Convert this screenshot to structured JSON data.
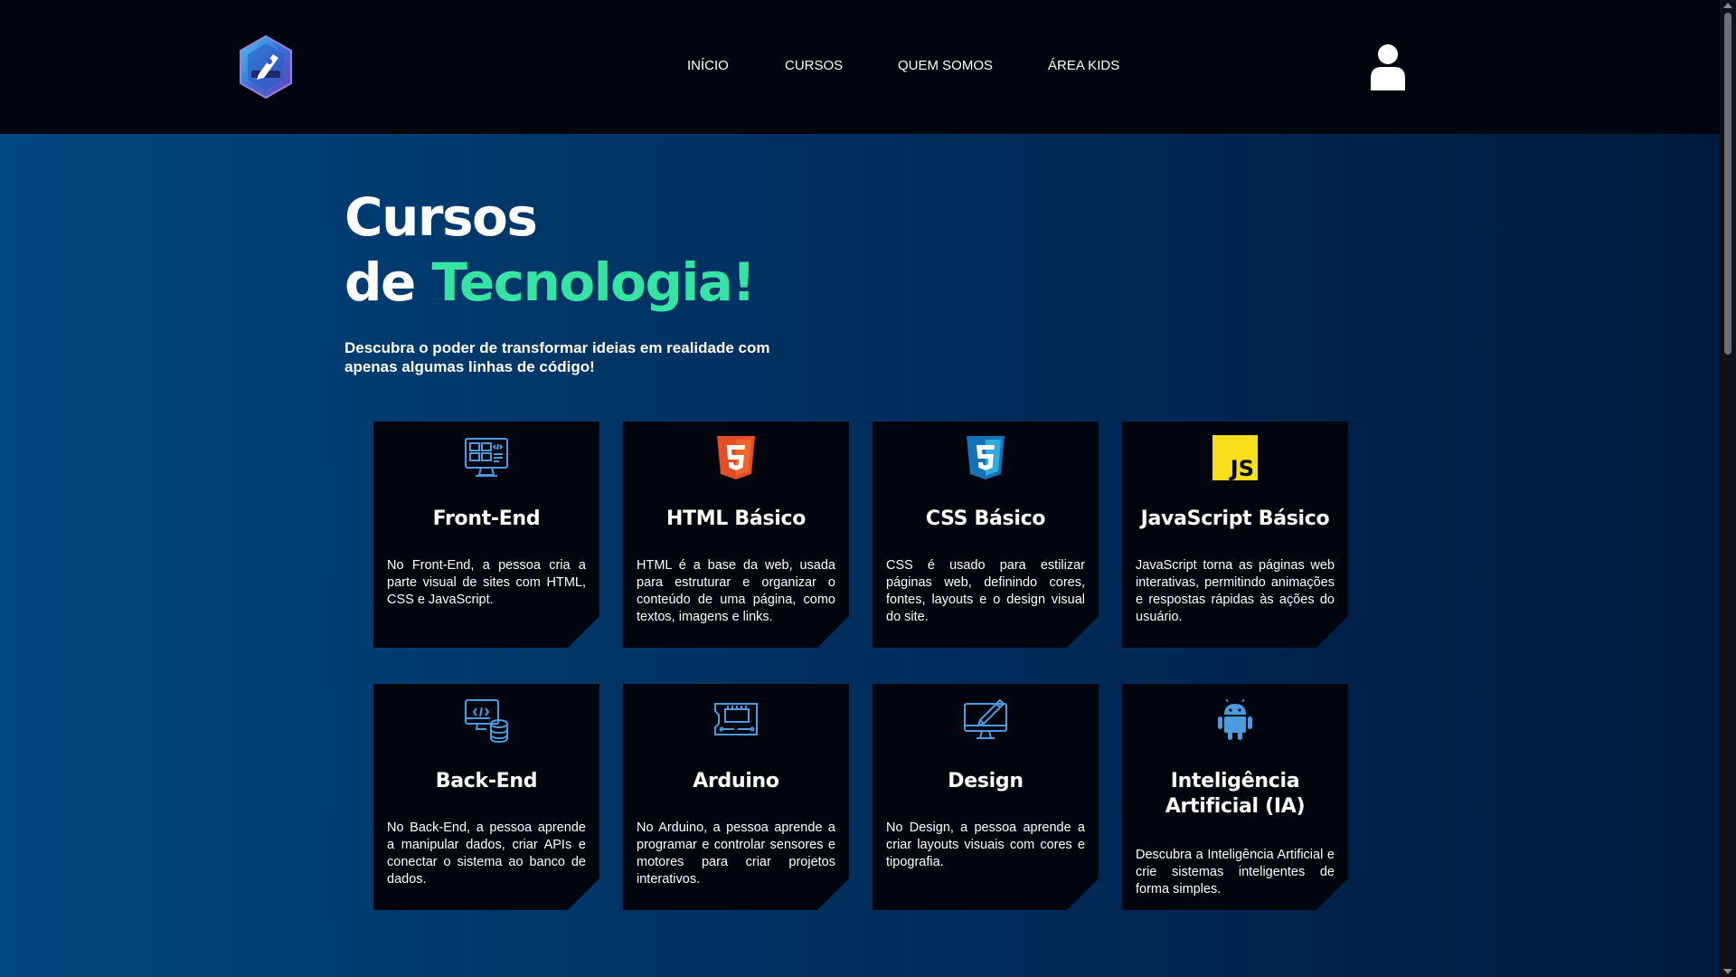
{
  "header": {
    "logo": "pen-hexagon-logo",
    "nav": [
      {
        "label": "INÍCIO"
      },
      {
        "label": "CURSOS"
      },
      {
        "label": "QUEM SOMOS"
      },
      {
        "label": "ÁREA KIDS"
      }
    ],
    "user_icon": "user-icon"
  },
  "hero": {
    "title_line1": "Cursos",
    "title_line2_prefix": "de ",
    "title_line2_accent": "Tecnologia!",
    "subtitle": "Descubra o poder de transformar ideias em realidade com apenas algumas linhas de código!"
  },
  "colors": {
    "accent": "#35e3a3",
    "card_bg": "#01050d",
    "icon_blue": "#4a9be0",
    "html_orange": "#e44d26",
    "css_blue": "#1572b6",
    "js_yellow": "#f7df1e"
  },
  "cards": [
    {
      "icon": "monitor-code-icon",
      "title": "Front-End",
      "desc": "No Front-End, a pessoa cria a parte visual de sites com HTML, CSS e JavaScript."
    },
    {
      "icon": "html5-icon",
      "title": "HTML Básico",
      "desc": "HTML é a base da web, usada para estruturar e organizar o conteúdo de uma página, como textos, imagens e links."
    },
    {
      "icon": "css3-icon",
      "title": "CSS Básico",
      "desc": "CSS é usado para estilizar páginas web, definindo cores, fontes, layouts e o design visual do site."
    },
    {
      "icon": "javascript-icon",
      "title": "JavaScript Básico",
      "desc": "JavaScript torna as páginas web interativas, permitindo animações e respostas rápidas às ações do usuário."
    },
    {
      "icon": "server-code-icon",
      "title": "Back-End",
      "desc": "No Back-End, a pessoa aprende a manipular dados, criar APIs e conectar o sistema ao banco de dados."
    },
    {
      "icon": "circuit-board-icon",
      "title": "Arduino",
      "desc": "No Arduino, a pessoa aprende a programar e controlar sensores e motores para criar projetos interativos."
    },
    {
      "icon": "monitor-pen-icon",
      "title": "Design",
      "desc": "No Design, a pessoa aprende a criar layouts visuais com cores e tipografia."
    },
    {
      "icon": "android-icon",
      "title_line1": "Inteligência",
      "title_line2": "Artificial (IA)",
      "desc": "Descubra a Inteligência Artificial e crie sistemas inteligentes de forma simples."
    }
  ]
}
